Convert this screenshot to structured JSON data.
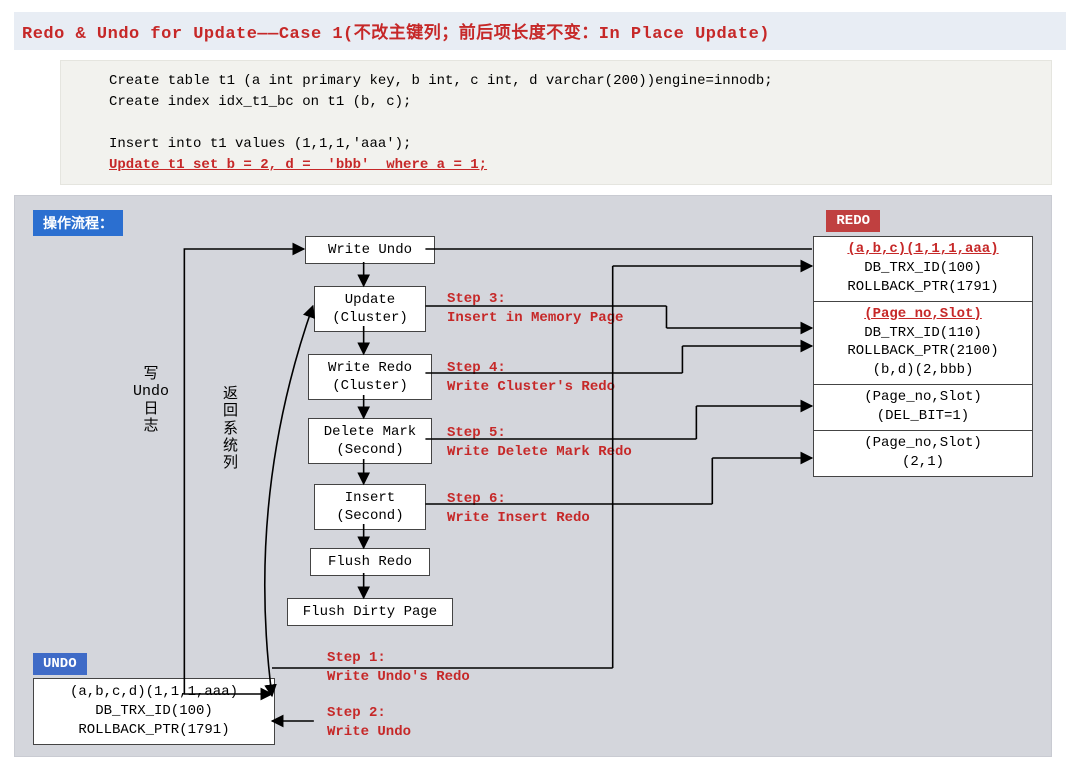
{
  "title": "Redo & Undo for Update——Case 1(不改主键列；前后项长度不变：In Place Update)",
  "sql": {
    "l1": "Create table t1 (a int primary key, b int, c int, d varchar(200))engine=innodb;",
    "l2": "Create index idx_t1_bc on t1 (b, c);",
    "l3": "Insert into t1 values (1,1,1,'aaa');",
    "l4": "Update t1 set b = 2, d =  'bbb'  where a = 1;"
  },
  "tags": {
    "ops": "操作流程：",
    "undo": "UNDO",
    "redo": "REDO"
  },
  "vlabels": {
    "write_undo": "写\nUndo\n日\n志",
    "ret_sys": "返\n回\n系\n统\n列"
  },
  "flow": {
    "b1": "Write Undo",
    "b2": "Update\n(Cluster)",
    "b3": "Write Redo\n(Cluster)",
    "b4": "Delete Mark\n(Second)",
    "b5": "Insert\n(Second)",
    "b6": "Flush Redo",
    "b7": "Flush Dirty Page"
  },
  "steps": {
    "s1": "Step 1:\nWrite Undo's Redo",
    "s2": "Step 2:\nWrite Undo",
    "s3": "Step 3:\nInsert in Memory Page",
    "s4": "Step 4:\nWrite Cluster's Redo",
    "s5": "Step 5:\nWrite Delete Mark Redo",
    "s6": "Step 6:\nWrite Insert Redo"
  },
  "undo_box": {
    "l1": "(a,b,c,d)(1,1,1,aaa)",
    "l2": "DB_TRX_ID(100)",
    "l3": "ROLLBACK_PTR(1791)"
  },
  "redo_cells": {
    "c1a": "(a,b,c)(1,1,1,aaa)",
    "c1b": "DB_TRX_ID(100)",
    "c1c": "ROLLBACK_PTR(1791)",
    "c2a": "(Page_no,Slot)",
    "c2b": "DB_TRX_ID(110)",
    "c2c": "ROLLBACK_PTR(2100)",
    "c2d": "(b,d)(2,bbb)",
    "c3a": "(Page_no,Slot)",
    "c3b": "(DEL_BIT=1)",
    "c4a": "(Page_no,Slot)",
    "c4b": "(2,1)"
  }
}
